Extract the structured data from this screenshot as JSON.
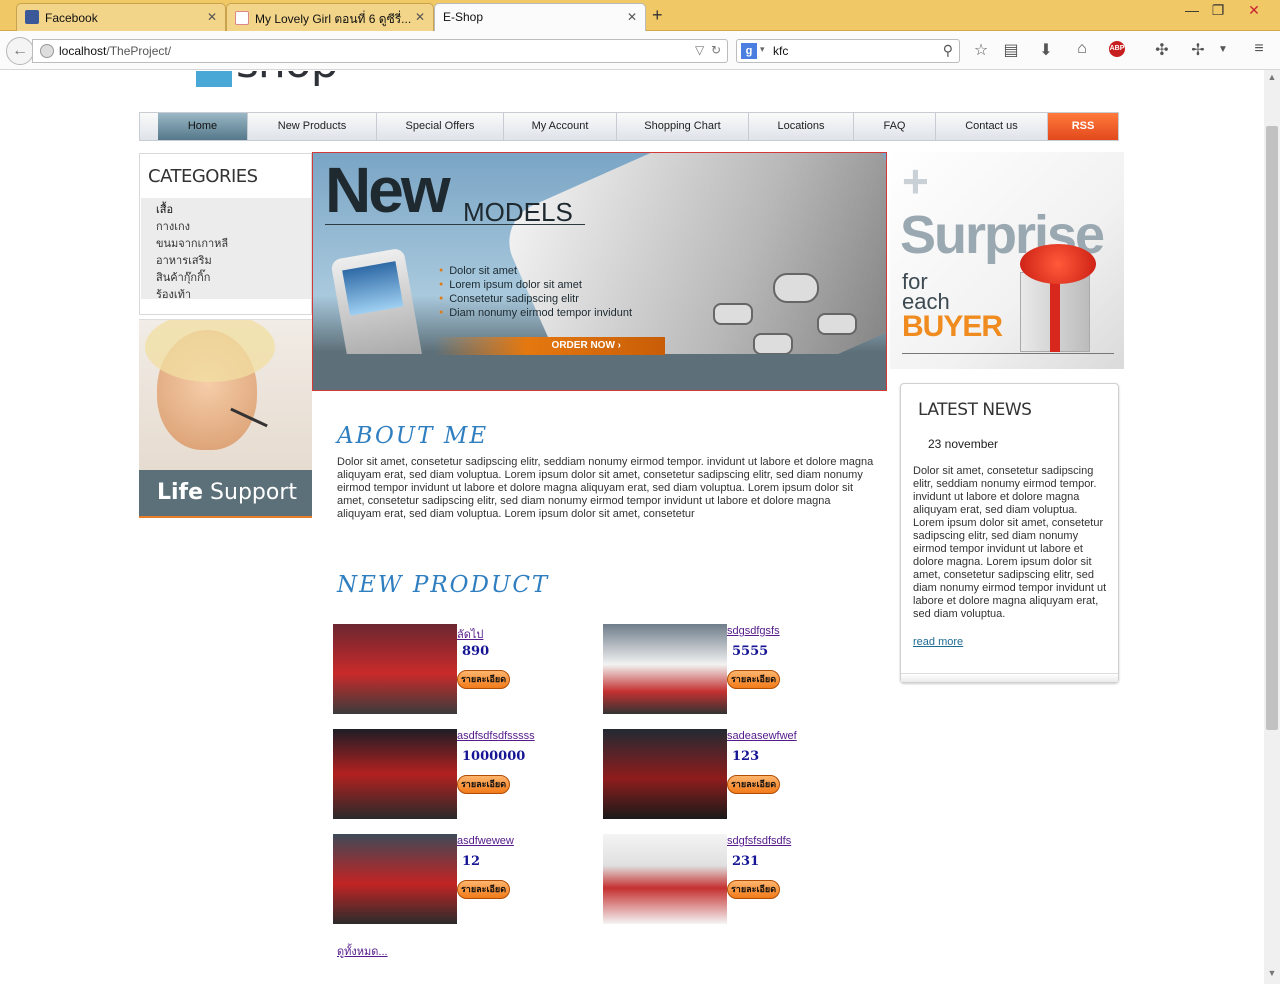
{
  "browser": {
    "tabs": [
      {
        "label": "Facebook",
        "icon": "facebook-icon",
        "active": false
      },
      {
        "label": "My Lovely Girl ตอนที่ 6 ดูซีรี่...",
        "icon": "heart-icon",
        "active": false
      },
      {
        "label": "E-Shop",
        "icon": "",
        "active": true
      }
    ],
    "url_host": "localhost",
    "url_path": "/TheProject/",
    "search_value": "kfc",
    "search_engine_icon": "google-icon"
  },
  "site": {
    "logo_text": "shop",
    "menu": [
      "Home",
      "New Products",
      "Special Offers",
      "My Account",
      "Shopping Chart",
      "Locations",
      "FAQ",
      "Contact us",
      "RSS"
    ],
    "categories_title": "CATEGORIES",
    "categories": [
      "เสื้อ",
      "กางเกง",
      "ขนมจากเกาหลี",
      "อาหารเสริม",
      "สินค้ากุ๊กกิ๊ก",
      "ร้องเท้า"
    ],
    "support_banner": {
      "bold": "Life",
      "rest": " Support"
    },
    "hero": {
      "title_big": "New",
      "title_small": "MODELS",
      "bullets": [
        "Dolor sit amet",
        "Lorem ipsum dolor sit amet",
        "Consetetur sadipscing elitr",
        "Diam nonumy eirmod tempor invidunt"
      ],
      "cta": "ORDER NOW ›"
    },
    "promo": {
      "line1": "Surprise",
      "line2": "for",
      "line3": "each",
      "line4": "BUYER"
    },
    "news": {
      "title": "LATEST NEWS",
      "date": "23 november",
      "body": "Dolor sit amet, consetetur sadipscing elitr, seddiam nonumy eirmod tempor. invidunt ut labore et dolore magna aliquyam erat, sed diam voluptua. Lorem ipsum dolor sit amet, consetetur sadipscing elitr, sed diam nonumy eirmod tempor invidunt ut labore et dolore magna. Lorem ipsum dolor sit amet, consetetur sadipscing elitr, sed diam nonumy eirmod tempor invidunt ut labore et dolore magna aliquyam erat, sed diam voluptua.",
      "read_more": "read more"
    },
    "about": {
      "title": "ABOUT ME",
      "body": "Dolor sit amet, consetetur sadipscing elitr, seddiam nonumy eirmod tempor. invidunt ut labore et dolore magna aliquyam erat, sed diam voluptua. Lorem ipsum dolor sit amet, consetetur sadipscing elitr, sed diam nonumy eirmod tempor invidunt ut labore et dolore magna aliquyam erat, sed diam voluptua. Lorem ipsum dolor sit amet, consetetur sadipscing elitr, sed diam nonumy eirmod tempor invidunt ut labore et dolore magna aliquyam erat, sed diam voluptua. Lorem ipsum dolor sit amet, consetetur"
    },
    "new_product_title": "NEW PRODUCT",
    "products": [
      {
        "name": "ลัดไป",
        "price": "890",
        "button": "รายละเอียด"
      },
      {
        "name": "sdgsdfgsfs",
        "price": "5555",
        "button": "รายละเอียด"
      },
      {
        "name": "asdfsdfsdfsssss",
        "price": "1000000",
        "button": "รายละเอียด"
      },
      {
        "name": "sadeasewfwef",
        "price": "123",
        "button": "รายละเอียด"
      },
      {
        "name": "asdfwewew",
        "price": "12",
        "button": "รายละเอียด"
      },
      {
        "name": "sdgfsfsdfsdfs",
        "price": "231",
        "button": "รายละเอียด"
      }
    ],
    "view_all": "ดูทั้งหมด..."
  },
  "colors": {
    "accent": "#2f7fc0",
    "rss": "#e2491c",
    "button": "#f27b1a",
    "price": "#151595"
  }
}
